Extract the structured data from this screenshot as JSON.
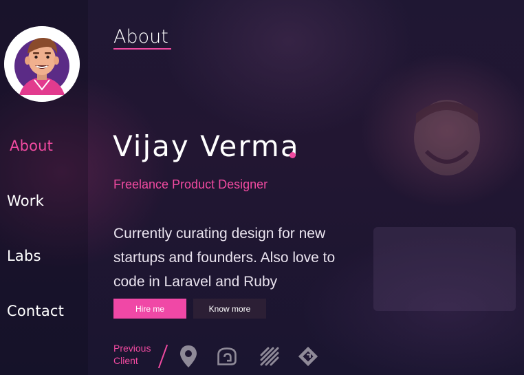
{
  "sidebar": {
    "avatar_alt": "avatar",
    "items": [
      {
        "label": "About",
        "active": true
      },
      {
        "label": "Work",
        "active": false
      },
      {
        "label": "Labs",
        "active": false
      },
      {
        "label": "Contact",
        "active": false
      }
    ]
  },
  "main": {
    "title": "About",
    "hero": {
      "name": "Vijay Verma",
      "subtitle": "Freelance Product Designer",
      "description": "Currently curating design for new startups and founders. Also love to code in Laravel and Ruby"
    },
    "buttons": {
      "hire": "Hire me",
      "know_more": "Know more"
    },
    "previous_clients": {
      "label_line1": "Previous",
      "label_line2": "Client",
      "logos": [
        "map-pin-icon",
        "speech-bubble-icon",
        "stripes-icon",
        "diamond-icon"
      ]
    }
  },
  "colors": {
    "accent": "#f04aa0",
    "background": "#1f1733",
    "button_dark": "#2c1f35",
    "text": "#ffffff"
  }
}
